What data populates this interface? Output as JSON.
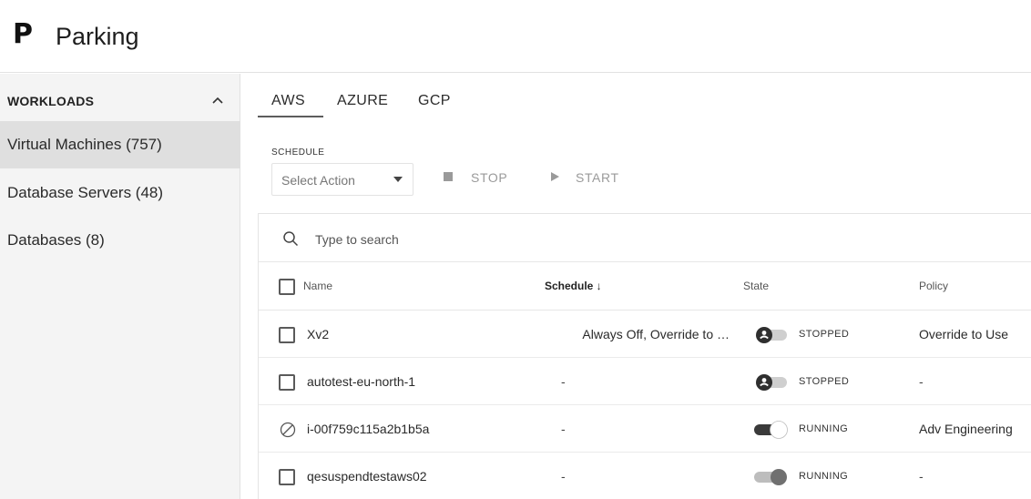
{
  "app": {
    "logo": "P",
    "title": "Parking"
  },
  "sidebar": {
    "heading": "WORKLOADS",
    "items": [
      {
        "label": "Virtual Machines (757)",
        "active": true
      },
      {
        "label": "Database Servers (48)",
        "active": false
      },
      {
        "label": "Databases (8)",
        "active": false
      }
    ]
  },
  "tabs": [
    {
      "label": "AWS",
      "active": true
    },
    {
      "label": "AZURE",
      "active": false
    },
    {
      "label": "GCP",
      "active": false
    }
  ],
  "schedule": {
    "label": "SCHEDULE",
    "select_value": "Select Action",
    "stop_label": "STOP",
    "start_label": "START"
  },
  "search": {
    "placeholder": "Type to search"
  },
  "table": {
    "columns": {
      "name": "Name",
      "schedule": "Schedule ↓",
      "state": "State",
      "policy": "Policy"
    },
    "rows": [
      {
        "name": "Xv2",
        "schedule": "Always Off, Override to …",
        "state": "STOPPED",
        "policy": "Override to Use",
        "selectable": true
      },
      {
        "name": "autotest-eu-north-1",
        "schedule": "-",
        "state": "STOPPED",
        "policy": "-",
        "selectable": true
      },
      {
        "name": "i-00f759c115a2b1b5a",
        "schedule": "-",
        "state": "RUNNING",
        "policy": "Adv Engineering",
        "selectable": false
      },
      {
        "name": "qesuspendtestaws02",
        "schedule": "-",
        "state": "RUNNING",
        "policy": "-",
        "selectable": true
      }
    ]
  },
  "colors": {
    "accent": "#5c5c5c",
    "sidebar_bg": "#f4f4f4",
    "active_item_bg": "#dfdfdf",
    "toggle_dark": "#3a3a3a",
    "toggle_light": "#cfcfcf"
  }
}
